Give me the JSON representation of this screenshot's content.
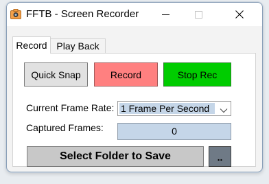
{
  "window": {
    "title": "FFTB - Screen Recorder",
    "app_icon": "camera-icon",
    "controls": [
      "minimize-icon",
      "maximize-icon",
      "close-icon"
    ]
  },
  "tabs": [
    {
      "label": "Record",
      "selected": true
    },
    {
      "label": "Play Back",
      "selected": false
    }
  ],
  "buttons": {
    "quick_snap": "Quick Snap",
    "record": "Record",
    "stop_rec": "Stop Rec",
    "select_folder": "Select Folder to Save",
    "browse": ".."
  },
  "fields": {
    "frame_rate_label": "Current Frame Rate:",
    "frame_rate_value": "1 Frame Per Second",
    "captured_frames_label": "Captured Frames:",
    "captured_frames_value": "0"
  },
  "colors": {
    "record_button": "#ff8080",
    "stop_button": "#00cc00",
    "field_highlight": "#c5d6e8",
    "browse_button": "#6f7a86"
  }
}
